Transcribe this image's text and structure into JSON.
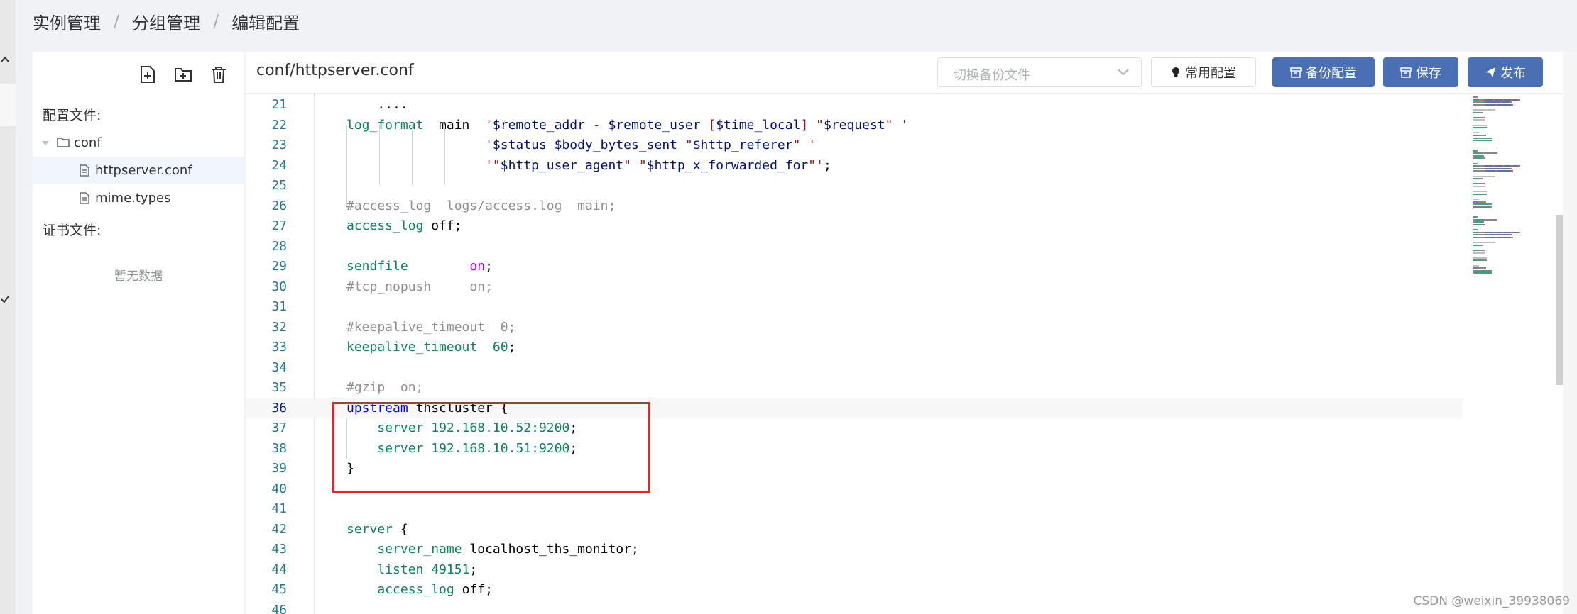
{
  "breadcrumb": {
    "items": [
      "实例管理",
      "分组管理",
      "编辑配置"
    ],
    "separator": "/"
  },
  "sidebar": {
    "config_label": "配置文件:",
    "tree": [
      {
        "label": "conf",
        "type": "folder",
        "expanded": true
      },
      {
        "label": "httpserver.conf",
        "type": "file",
        "selected": true
      },
      {
        "label": "mime.types",
        "type": "file",
        "selected": false
      }
    ],
    "cert_label": "证书文件:",
    "cert_empty": "暂无数据",
    "tools": [
      "new-file-icon",
      "new-folder-icon",
      "delete-icon"
    ]
  },
  "toolbar": {
    "file_path": "conf/httpserver.conf",
    "backup_select_placeholder": "切换备份文件",
    "common_config_label": "常用配置",
    "backup_config_label": "备份配置",
    "save_label": "保存",
    "publish_label": "发布"
  },
  "editor": {
    "lines": [
      {
        "n": "21",
        "tokens": [
          [
            "plain",
            "    ...."
          ]
        ]
      },
      {
        "n": "22",
        "tokens": [
          [
            "dir",
            "log_format"
          ],
          [
            "plain",
            "  main  "
          ],
          [
            "str",
            "'"
          ],
          [
            "var",
            "$remote_addr"
          ],
          [
            "str",
            " - "
          ],
          [
            "var",
            "$remote_user"
          ],
          [
            "str",
            " ["
          ],
          [
            "var",
            "$time_local"
          ],
          [
            "str",
            "] \""
          ],
          [
            "var",
            "$request"
          ],
          [
            "str",
            "\" '"
          ]
        ]
      },
      {
        "n": "23",
        "tokens": [
          [
            "plain",
            "                  "
          ],
          [
            "str",
            "'"
          ],
          [
            "var",
            "$status"
          ],
          [
            "str",
            " "
          ],
          [
            "var",
            "$body_bytes_sent"
          ],
          [
            "str",
            " \""
          ],
          [
            "var",
            "$http_referer"
          ],
          [
            "str",
            "\" '"
          ]
        ]
      },
      {
        "n": "24",
        "tokens": [
          [
            "plain",
            "                  "
          ],
          [
            "str",
            "'\""
          ],
          [
            "var",
            "$http_user_agent"
          ],
          [
            "str",
            "\" \""
          ],
          [
            "var",
            "$http_x_forwarded_for"
          ],
          [
            "str",
            "\"'"
          ],
          [
            "plain",
            ";"
          ]
        ]
      },
      {
        "n": "25",
        "tokens": []
      },
      {
        "n": "26",
        "tokens": [
          [
            "cm",
            "#access_log  logs/access.log  main;"
          ]
        ]
      },
      {
        "n": "27",
        "tokens": [
          [
            "dir",
            "access_log"
          ],
          [
            "plain",
            " off;"
          ]
        ]
      },
      {
        "n": "28",
        "tokens": []
      },
      {
        "n": "29",
        "tokens": [
          [
            "dir",
            "sendfile"
          ],
          [
            "plain",
            "        "
          ],
          [
            "on",
            "on"
          ],
          [
            "plain",
            ";"
          ]
        ]
      },
      {
        "n": "30",
        "tokens": [
          [
            "cm",
            "#tcp_nopush     on;"
          ]
        ]
      },
      {
        "n": "31",
        "tokens": []
      },
      {
        "n": "32",
        "tokens": [
          [
            "cm",
            "#keepalive_timeout  0;"
          ]
        ]
      },
      {
        "n": "33",
        "tokens": [
          [
            "dir",
            "keepalive_timeout"
          ],
          [
            "plain",
            "  "
          ],
          [
            "ip",
            "60"
          ],
          [
            "plain",
            ";"
          ]
        ]
      },
      {
        "n": "34",
        "tokens": []
      },
      {
        "n": "35",
        "tokens": [
          [
            "cm",
            "#gzip  on;"
          ]
        ]
      },
      {
        "n": "36",
        "tokens": [
          [
            "kw",
            "upstream"
          ],
          [
            "plain",
            " thscluster {"
          ]
        ]
      },
      {
        "n": "37",
        "tokens": [
          [
            "plain",
            "    "
          ],
          [
            "dir",
            "server"
          ],
          [
            "plain",
            " "
          ],
          [
            "ip",
            "192.168.10.52:9200"
          ],
          [
            "plain",
            ";"
          ]
        ]
      },
      {
        "n": "38",
        "tokens": [
          [
            "plain",
            "    "
          ],
          [
            "dir",
            "server"
          ],
          [
            "plain",
            " "
          ],
          [
            "ip",
            "192.168.10.51:9200"
          ],
          [
            "plain",
            ";"
          ]
        ]
      },
      {
        "n": "39",
        "tokens": [
          [
            "plain",
            "}"
          ]
        ]
      },
      {
        "n": "40",
        "tokens": []
      },
      {
        "n": "41",
        "tokens": []
      },
      {
        "n": "42",
        "tokens": [
          [
            "dir",
            "server"
          ],
          [
            "plain",
            " {"
          ]
        ]
      },
      {
        "n": "43",
        "tokens": [
          [
            "plain",
            "    "
          ],
          [
            "dir",
            "server_name"
          ],
          [
            "plain",
            " localhost_ths_monitor;"
          ]
        ]
      },
      {
        "n": "44",
        "tokens": [
          [
            "plain",
            "    "
          ],
          [
            "dir",
            "listen"
          ],
          [
            "plain",
            " "
          ],
          [
            "ip",
            "49151"
          ],
          [
            "plain",
            ";"
          ]
        ]
      },
      {
        "n": "45",
        "tokens": [
          [
            "plain",
            "    "
          ],
          [
            "dir",
            "access_log"
          ],
          [
            "plain",
            " off;"
          ]
        ]
      },
      {
        "n": "46",
        "tokens": []
      }
    ],
    "current_line": "36"
  },
  "watermark": "CSDN @weixin_39938069",
  "colors": {
    "primary": "#4a6fb5",
    "highlight_border": "#e6242b",
    "line_number": "#237893"
  }
}
